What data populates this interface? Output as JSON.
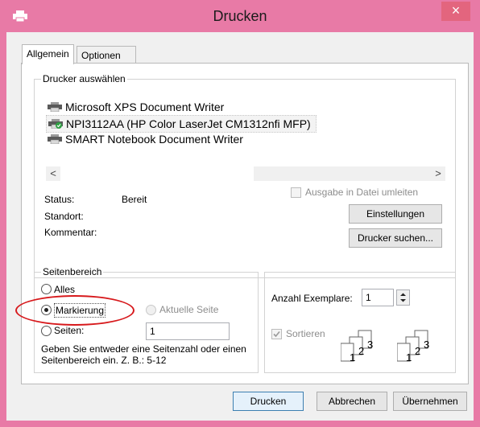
{
  "window": {
    "title": "Drucken",
    "close_glyph": "×",
    "app_icon": "printer-icon",
    "border_color": "#e87aa6"
  },
  "tabs": [
    {
      "label": "Allgemein",
      "active": true
    },
    {
      "label": "Optionen",
      "active": false
    }
  ],
  "printer_group": {
    "title": "Drucker auswählen",
    "printers": [
      {
        "name": "Microsoft XPS Document Writer",
        "icon": "printer-icon",
        "selected": false
      },
      {
        "name": "NPI3112AA (HP Color LaserJet CM1312nfi MFP)",
        "icon": "default-printer-icon",
        "selected": true
      },
      {
        "name": "SMART Notebook Document Writer",
        "icon": "printer-icon",
        "selected": false
      }
    ],
    "scroll_left": "<",
    "scroll_right": ">",
    "status_label": "Status:",
    "status_value": "Bereit",
    "location_label": "Standort:",
    "location_value": "",
    "comment_label": "Kommentar:",
    "comment_value": "",
    "print_to_file_label": "Ausgabe in Datei umleiten",
    "print_to_file_checked": false,
    "settings_button": "Einstellungen",
    "find_printer_button": "Drucker suchen..."
  },
  "page_range": {
    "title": "Seitenbereich",
    "options": {
      "all": "Alles",
      "selection": "Markierung",
      "current_page": "Aktuelle Seite",
      "pages": "Seiten:"
    },
    "selected": "selection",
    "pages_value": "1",
    "hint": "Geben Sie entweder eine Seitenzahl oder einen Seitenbereich ein. Z. B.: 5-12"
  },
  "copies": {
    "label": "Anzahl Exemplare:",
    "value": "1",
    "collate_label": "Sortieren",
    "collate_checked": true,
    "collate_digits": [
      "1",
      "2",
      "3"
    ]
  },
  "footer": {
    "print_button": "Drucken",
    "cancel_button": "Abbrechen",
    "apply_button": "Übernehmen"
  },
  "annotation": {
    "highlight_color": "#d7191c"
  }
}
